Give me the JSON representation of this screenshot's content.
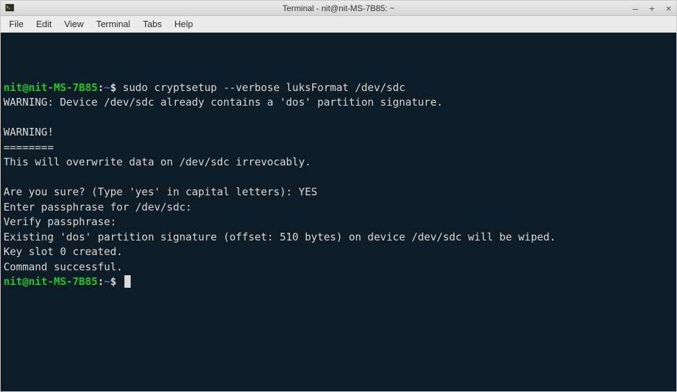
{
  "window": {
    "title": "Terminal - nit@nit-MS-7B85: ~",
    "buttons": {
      "min": "–",
      "max": "+",
      "close": "×"
    }
  },
  "menubar": {
    "items": [
      "File",
      "Edit",
      "View",
      "Terminal",
      "Tabs",
      "Help"
    ]
  },
  "terminal": {
    "prompt": {
      "user_host": "nit@nit-MS-7B85",
      "sep": ":",
      "path": "~",
      "dollar": "$ "
    },
    "session": [
      {
        "type": "prompt",
        "command": "sudo cryptsetup --verbose luksFormat /dev/sdc"
      },
      {
        "type": "out",
        "text": "WARNING: Device /dev/sdc already contains a 'dos' partition signature."
      },
      {
        "type": "out",
        "text": ""
      },
      {
        "type": "out",
        "text": "WARNING!"
      },
      {
        "type": "out",
        "text": "========"
      },
      {
        "type": "out",
        "text": "This will overwrite data on /dev/sdc irrevocably."
      },
      {
        "type": "out",
        "text": ""
      },
      {
        "type": "out",
        "text": "Are you sure? (Type 'yes' in capital letters): YES"
      },
      {
        "type": "out",
        "text": "Enter passphrase for /dev/sdc: "
      },
      {
        "type": "out",
        "text": "Verify passphrase: "
      },
      {
        "type": "out",
        "text": "Existing 'dos' partition signature (offset: 510 bytes) on device /dev/sdc will be wiped."
      },
      {
        "type": "out",
        "text": "Key slot 0 created."
      },
      {
        "type": "out",
        "text": "Command successful."
      },
      {
        "type": "prompt",
        "command": "",
        "cursor": true
      }
    ]
  }
}
